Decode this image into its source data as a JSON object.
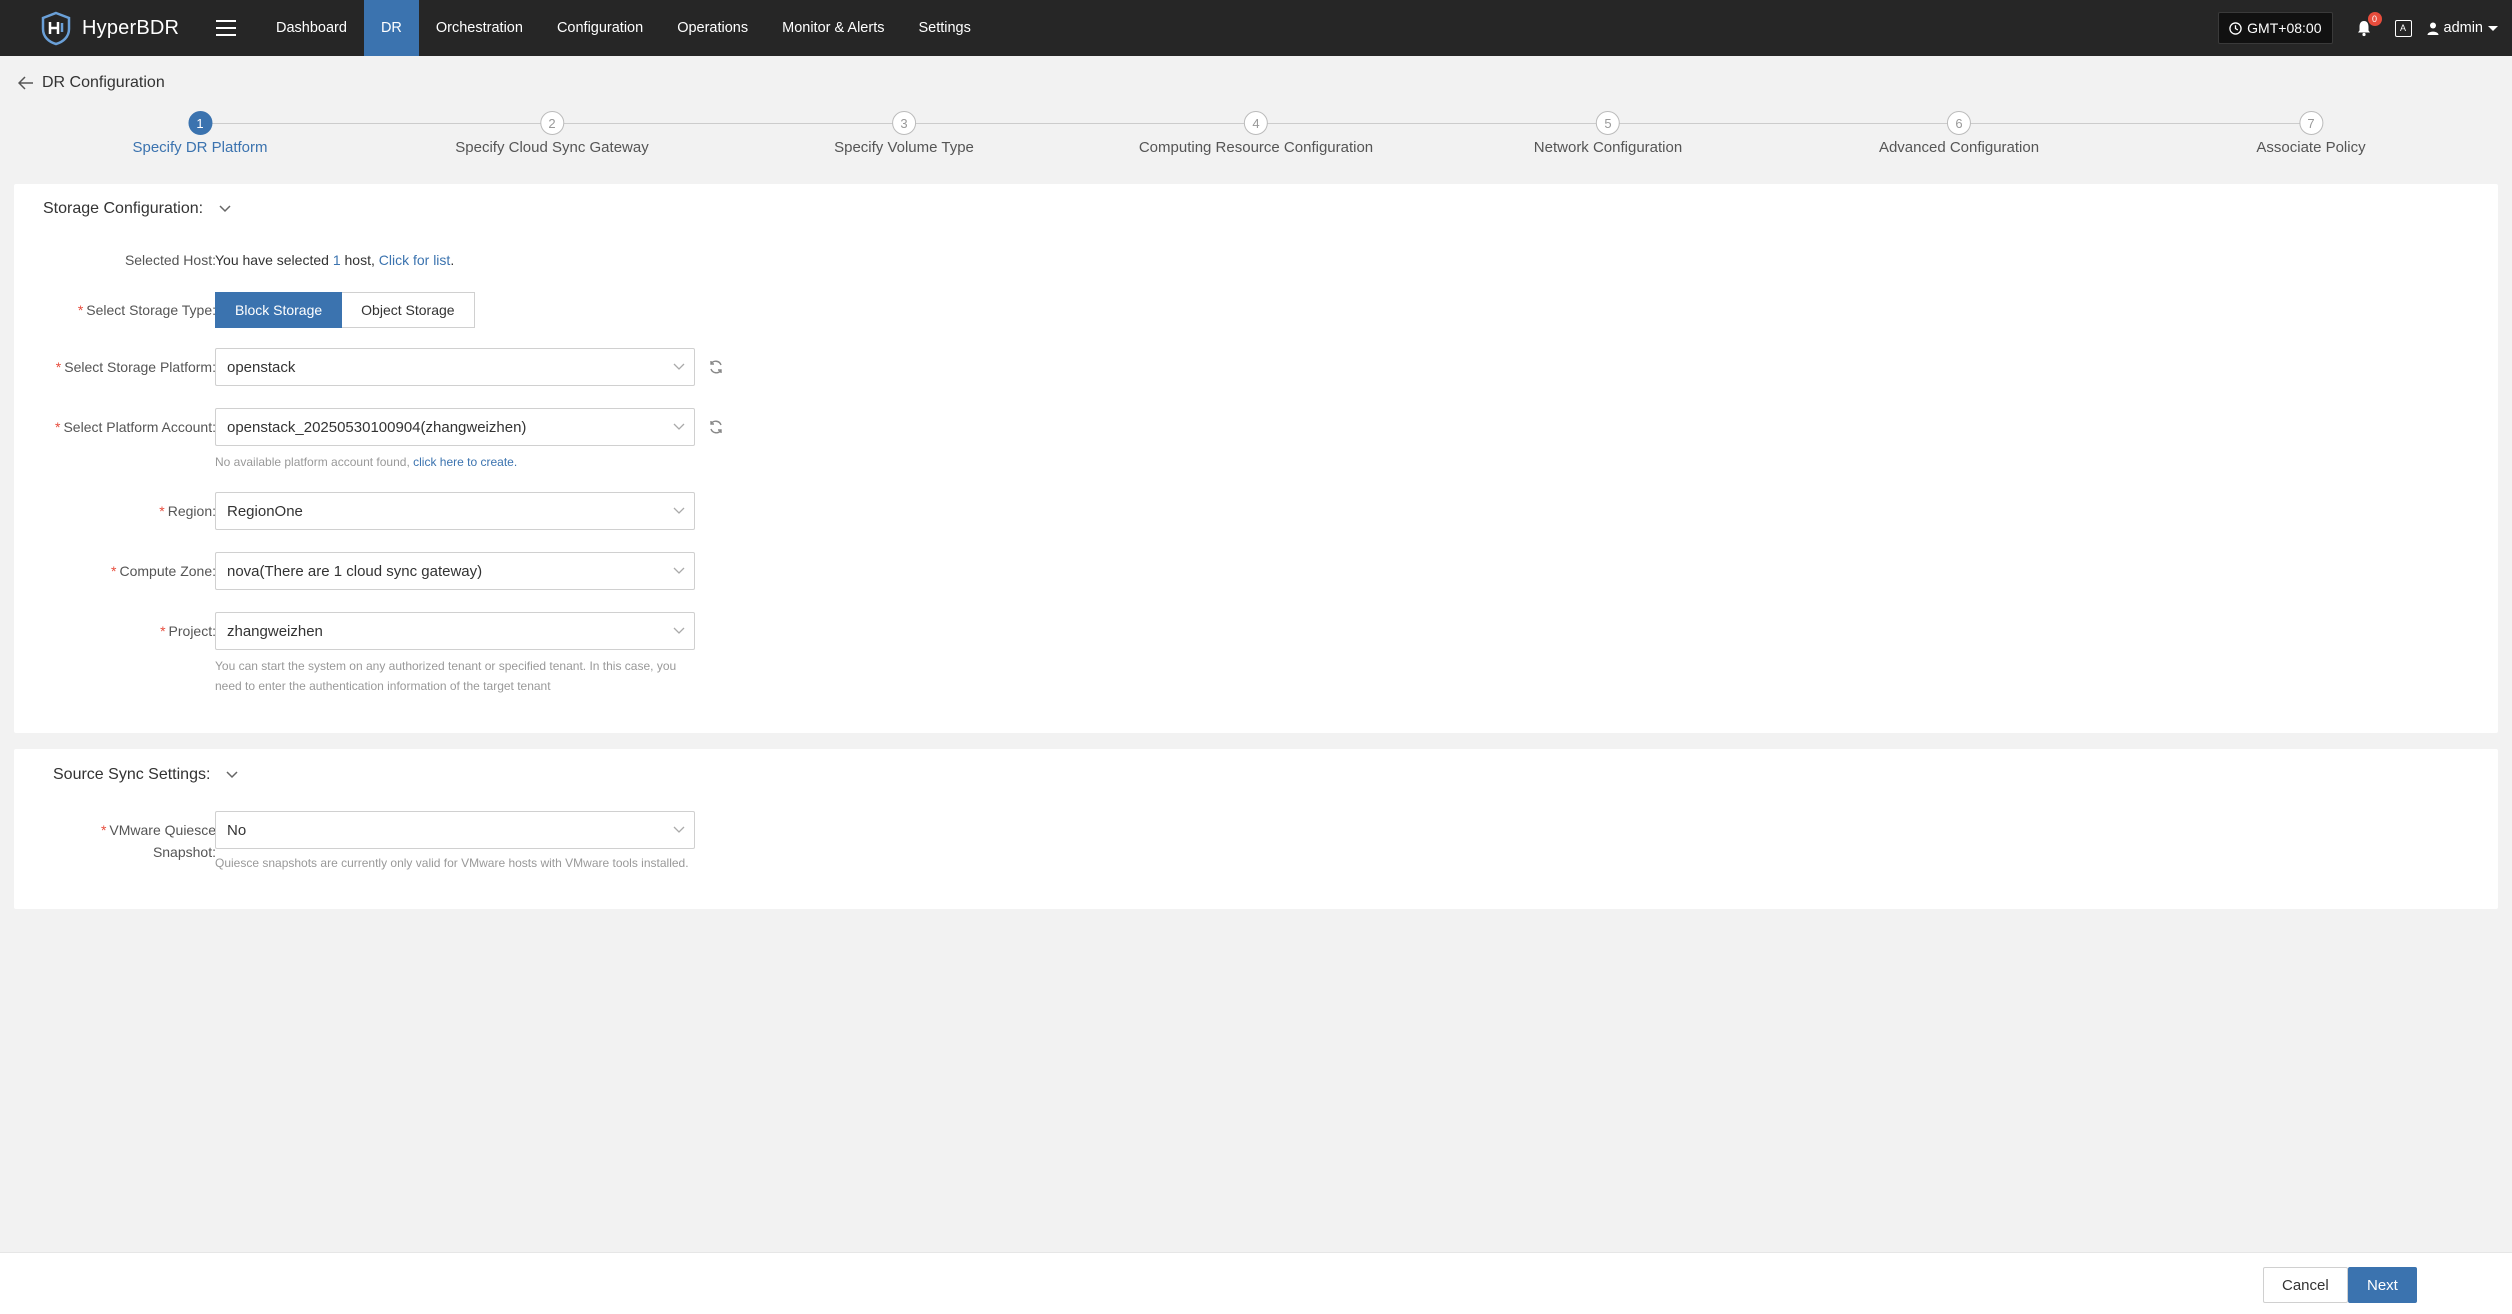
{
  "app": {
    "name": "HyperBDR"
  },
  "nav": [
    {
      "label": "Dashboard"
    },
    {
      "label": "DR"
    },
    {
      "label": "Orchestration"
    },
    {
      "label": "Configuration"
    },
    {
      "label": "Operations"
    },
    {
      "label": "Monitor & Alerts"
    },
    {
      "label": "Settings"
    }
  ],
  "topbar": {
    "timezone": "GMT+08:00",
    "notification_count": "0",
    "lang_icon_text": "A",
    "user": "admin"
  },
  "page": {
    "title": "DR Configuration"
  },
  "steps": [
    {
      "num": "1",
      "label": "Specify DR Platform"
    },
    {
      "num": "2",
      "label": "Specify Cloud Sync Gateway"
    },
    {
      "num": "3",
      "label": "Specify Volume Type"
    },
    {
      "num": "4",
      "label": "Computing Resource Configuration"
    },
    {
      "num": "5",
      "label": "Network Configuration"
    },
    {
      "num": "6",
      "label": "Advanced Configuration"
    },
    {
      "num": "7",
      "label": "Associate Policy"
    }
  ],
  "storage": {
    "title": "Storage Configuration:",
    "selected_host_label": "Selected Host:",
    "selected_host_prefix": "You have selected",
    "selected_host_count": "1",
    "selected_host_suffix": "host,",
    "click_for_list": "Click for list",
    "storage_type_label": "Select Storage Type:",
    "block_storage": "Block Storage",
    "object_storage": "Object Storage",
    "platform_label": "Select Storage Platform:",
    "platform_value": "openstack",
    "account_label": "Select Platform Account:",
    "account_value": "openstack_20250530100904(zhangweizhen)",
    "account_hint": "No available platform account found,",
    "account_hint_link": "click here to create.",
    "region_label": "Region:",
    "region_value": "RegionOne",
    "zone_label": "Compute Zone:",
    "zone_value": "nova(There are 1 cloud sync gateway)",
    "project_label": "Project:",
    "project_value": "zhangweizhen",
    "project_hint_1": "You can start the system on any authorized tenant or specified tenant. In this case, you",
    "project_hint_2": "need to enter the authentication information of the target tenant"
  },
  "source_sync": {
    "title": "Source Sync Settings:",
    "quiesce_label_1": "VMware Quiesce",
    "quiesce_label_2": "Snapshot:",
    "quiesce_value": "No",
    "quiesce_hint": "Quiesce snapshots are currently only valid for VMware hosts with VMware tools installed."
  },
  "footer": {
    "cancel": "Cancel",
    "next": "Next"
  }
}
